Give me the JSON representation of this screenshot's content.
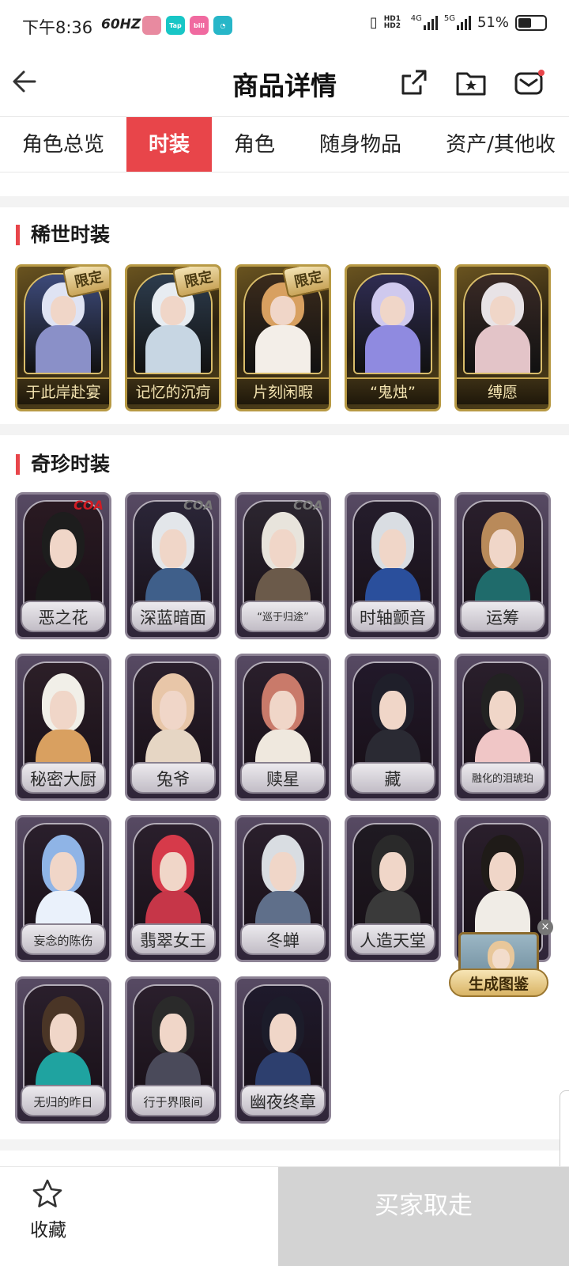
{
  "status_bar": {
    "time": "下午8:36",
    "refresh": "60HZ",
    "battery": "51%",
    "battery_level": 0.51,
    "net1": "4G",
    "net2": "5G",
    "hd": "HD1 HD2"
  },
  "header": {
    "title": "商品详情",
    "back_icon": "arrow-left-icon",
    "share_icon": "share-external-icon",
    "folder_icon": "folder-star-icon",
    "message_icon": "mail-icon"
  },
  "tabs": [
    {
      "label": "角色总览",
      "active": false
    },
    {
      "label": "时装",
      "active": true
    },
    {
      "label": "角色",
      "active": false
    },
    {
      "label": "随身物品",
      "active": false
    },
    {
      "label": "资产/其他收",
      "active": false
    }
  ],
  "sections": {
    "rare": {
      "title": "稀世时装",
      "items": [
        {
          "name": "于此岸赴宴",
          "badge": "限定"
        },
        {
          "name": "记忆的沉疴",
          "badge": "限定"
        },
        {
          "name": "片刻闲暇",
          "badge": "限定"
        },
        {
          "name": "“鬼烛”",
          "badge": ""
        },
        {
          "name": "缚愿",
          "badge": ""
        }
      ]
    },
    "precious": {
      "title": "奇珍时装",
      "items": [
        {
          "name": "恶之花",
          "tag": "COA"
        },
        {
          "name": "深蓝暗面",
          "tag": "COA"
        },
        {
          "name": "“巡于归途”",
          "tag": "COA"
        },
        {
          "name": "时轴颤音",
          "tag": ""
        },
        {
          "name": "运筹",
          "tag": ""
        },
        {
          "name": "秘密大厨",
          "tag": ""
        },
        {
          "name": "兔爷",
          "tag": ""
        },
        {
          "name": "赎星",
          "tag": ""
        },
        {
          "name": "藏",
          "tag": ""
        },
        {
          "name": "融化的泪琥珀",
          "tag": ""
        },
        {
          "name": "妄念的陈伤",
          "tag": ""
        },
        {
          "name": "翡翠女王",
          "tag": ""
        },
        {
          "name": "冬蝉",
          "tag": ""
        },
        {
          "name": "人造天堂",
          "tag": ""
        },
        {
          "name": "",
          "tag": ""
        },
        {
          "name": "无归的昨日",
          "tag": ""
        },
        {
          "name": "行于界限间",
          "tag": ""
        },
        {
          "name": "幽夜终章",
          "tag": ""
        }
      ]
    }
  },
  "floating": {
    "label": "生成图鉴",
    "close": "×"
  },
  "bottom_bar": {
    "favorite_label": "收藏",
    "favorite_icon": "star-outline-icon",
    "buy_label": "买家取走"
  },
  "colors": {
    "accent": "#e8454a",
    "buy_disabled": "#d3d3d3"
  }
}
